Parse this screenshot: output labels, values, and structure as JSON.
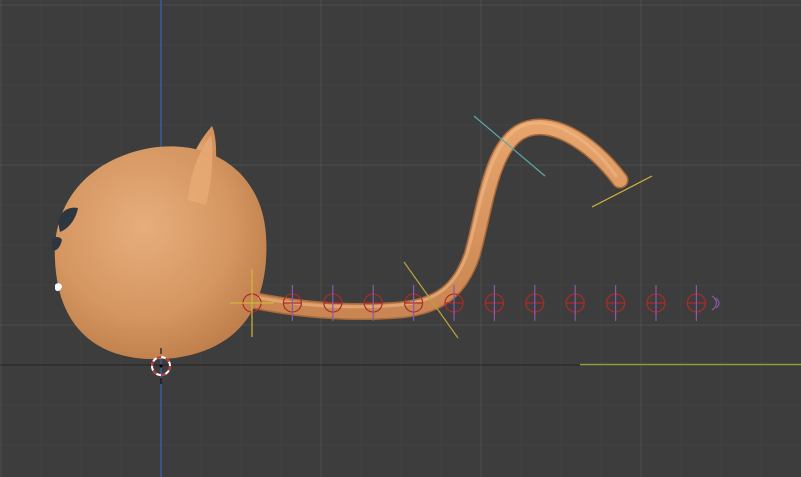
{
  "viewport": {
    "background_color": "#3d3d3d",
    "grid_minor_color": "#444444",
    "grid_major_color": "#4d4d4d",
    "z_axis_color": "#3a5c9e",
    "x_axis_color": "#8a9a3c",
    "floor_line_color": "#2a2a2a"
  },
  "model": {
    "name": "cat-head",
    "skin_color": "#d99a67",
    "eyebrow_color": "#2e3640"
  },
  "tail_curve": {
    "control_point_count": 12,
    "control_point_color": "#b02a2a",
    "first_point_color": "#d2b43a",
    "handle_colors": [
      "#b9a23a",
      "#5aa9a9"
    ]
  },
  "cursor": {
    "name": "3d-cursor",
    "colors": [
      "#ffffff",
      "#c03030"
    ]
  }
}
